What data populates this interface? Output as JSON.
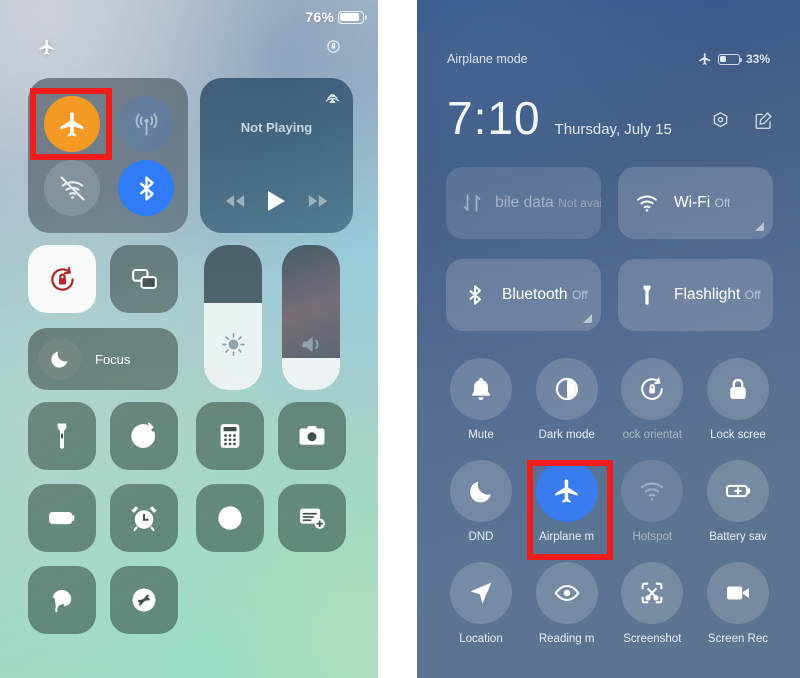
{
  "ios": {
    "status": {
      "battery_percent": "76%",
      "battery_level": 76
    },
    "sub_status": {
      "airplane_icon": "airplane-icon",
      "rotation_lock_icon": "rotation-lock-icon"
    },
    "connectivity": {
      "airplane": {
        "name": "airplane-mode",
        "state": "on",
        "color": "#f49a24"
      },
      "cellular": {
        "name": "cellular-data",
        "state": "off"
      },
      "wifi": {
        "name": "wifi",
        "state": "off"
      },
      "bluetooth": {
        "name": "bluetooth",
        "state": "on",
        "color": "#2f7cf6"
      }
    },
    "media": {
      "title": "Not Playing",
      "airplay_icon": "airplay-icon",
      "prev": "rewind-icon",
      "play": "play-icon",
      "next": "fast-forward-icon"
    },
    "rotation_lock": {
      "label": "rotation-lock",
      "state": "on",
      "icon_color": "#b02a2a"
    },
    "screen_mirroring": {
      "label": "screen-mirroring"
    },
    "focus": {
      "label": "Focus"
    },
    "brightness": {
      "label": "brightness",
      "value": 60
    },
    "volume": {
      "label": "volume",
      "value": 22
    },
    "tiles_row3": [
      {
        "icon": "flashlight-icon"
      },
      {
        "icon": "timer-icon"
      },
      {
        "icon": "calculator-icon"
      },
      {
        "icon": "camera-icon"
      }
    ],
    "tiles_row4": [
      {
        "icon": "low-power-mode-icon"
      },
      {
        "icon": "alarm-icon"
      },
      {
        "icon": "screen-record-icon"
      },
      {
        "icon": "quick-note-icon"
      }
    ],
    "tiles_row5": [
      {
        "icon": "hearing-icon"
      },
      {
        "icon": "shazam-icon"
      }
    ]
  },
  "miui": {
    "status": {
      "left_text": "Airplane mode",
      "airplane_icon": "airplane-icon",
      "battery_percent": "33%",
      "battery_level": 33
    },
    "clock": {
      "time": "7:10",
      "date": "Thursday, July 15"
    },
    "header_icons": [
      {
        "name": "settings-icon"
      },
      {
        "name": "edit-icon"
      }
    ],
    "big_tiles": [
      {
        "name": "mobile-data",
        "title": "bile data",
        "sub": "Not available",
        "icon": "mobile-data-icon",
        "state": "unavailable",
        "expandable": false
      },
      {
        "name": "wifi",
        "title": "Wi-Fi",
        "sub": "Off",
        "icon": "wifi-icon",
        "state": "off",
        "expandable": true
      },
      {
        "name": "bluetooth",
        "title": "Bluetooth",
        "sub": "Off",
        "icon": "bluetooth-icon",
        "state": "off",
        "expandable": true
      },
      {
        "name": "flashlight",
        "title": "Flashlight",
        "sub": "Off",
        "icon": "flashlight-icon",
        "state": "off",
        "expandable": false
      }
    ],
    "grid_row1": [
      {
        "label": "Mute",
        "icon": "bell-icon",
        "state": "off"
      },
      {
        "label": "Dark mode",
        "icon": "contrast-icon",
        "state": "off"
      },
      {
        "label": "ock orientat",
        "icon": "rotation-lock-icon",
        "state": "off"
      },
      {
        "label": "Lock scree",
        "icon": "padlock-icon",
        "state": "off"
      }
    ],
    "grid_row2": [
      {
        "label": "DND",
        "icon": "moon-icon",
        "state": "off"
      },
      {
        "label": "Airplane m",
        "icon": "airplane-icon",
        "state": "on"
      },
      {
        "label": "Hotspot",
        "icon": "hotspot-icon",
        "state": "disabled"
      },
      {
        "label": "Battery sav",
        "icon": "battery-saver-icon",
        "state": "off"
      }
    ],
    "grid_row3": [
      {
        "label": "Location",
        "icon": "location-arrow-icon",
        "state": "off"
      },
      {
        "label": "Reading m",
        "icon": "eye-icon",
        "state": "off"
      },
      {
        "label": "Screenshot",
        "icon": "screenshot-icon",
        "state": "off"
      },
      {
        "label": "Screen Rec",
        "icon": "video-camera-icon",
        "state": "off"
      }
    ]
  },
  "highlights": {
    "color": "#ef1c1c",
    "ios_target": "airplane-mode-toggle",
    "miui_target": "airplane-mode-tile"
  }
}
